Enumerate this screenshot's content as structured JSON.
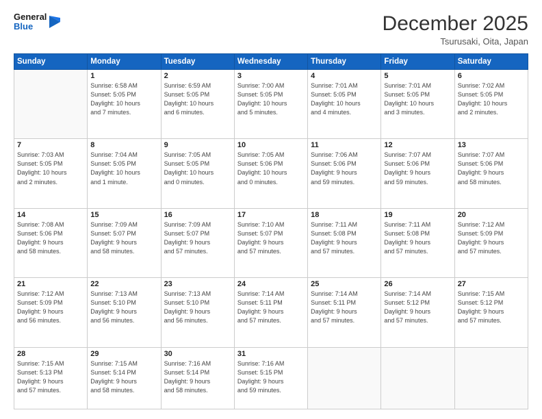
{
  "logo": {
    "line1": "General",
    "line2": "Blue"
  },
  "header": {
    "month_year": "December 2025",
    "location": "Tsurusaki, Oita, Japan"
  },
  "weekdays": [
    "Sunday",
    "Monday",
    "Tuesday",
    "Wednesday",
    "Thursday",
    "Friday",
    "Saturday"
  ],
  "weeks": [
    [
      {
        "day": "",
        "info": ""
      },
      {
        "day": "1",
        "info": "Sunrise: 6:58 AM\nSunset: 5:05 PM\nDaylight: 10 hours\nand 7 minutes."
      },
      {
        "day": "2",
        "info": "Sunrise: 6:59 AM\nSunset: 5:05 PM\nDaylight: 10 hours\nand 6 minutes."
      },
      {
        "day": "3",
        "info": "Sunrise: 7:00 AM\nSunset: 5:05 PM\nDaylight: 10 hours\nand 5 minutes."
      },
      {
        "day": "4",
        "info": "Sunrise: 7:01 AM\nSunset: 5:05 PM\nDaylight: 10 hours\nand 4 minutes."
      },
      {
        "day": "5",
        "info": "Sunrise: 7:01 AM\nSunset: 5:05 PM\nDaylight: 10 hours\nand 3 minutes."
      },
      {
        "day": "6",
        "info": "Sunrise: 7:02 AM\nSunset: 5:05 PM\nDaylight: 10 hours\nand 2 minutes."
      }
    ],
    [
      {
        "day": "7",
        "info": "Sunrise: 7:03 AM\nSunset: 5:05 PM\nDaylight: 10 hours\nand 2 minutes."
      },
      {
        "day": "8",
        "info": "Sunrise: 7:04 AM\nSunset: 5:05 PM\nDaylight: 10 hours\nand 1 minute."
      },
      {
        "day": "9",
        "info": "Sunrise: 7:05 AM\nSunset: 5:05 PM\nDaylight: 10 hours\nand 0 minutes."
      },
      {
        "day": "10",
        "info": "Sunrise: 7:05 AM\nSunset: 5:06 PM\nDaylight: 10 hours\nand 0 minutes."
      },
      {
        "day": "11",
        "info": "Sunrise: 7:06 AM\nSunset: 5:06 PM\nDaylight: 9 hours\nand 59 minutes."
      },
      {
        "day": "12",
        "info": "Sunrise: 7:07 AM\nSunset: 5:06 PM\nDaylight: 9 hours\nand 59 minutes."
      },
      {
        "day": "13",
        "info": "Sunrise: 7:07 AM\nSunset: 5:06 PM\nDaylight: 9 hours\nand 58 minutes."
      }
    ],
    [
      {
        "day": "14",
        "info": "Sunrise: 7:08 AM\nSunset: 5:06 PM\nDaylight: 9 hours\nand 58 minutes."
      },
      {
        "day": "15",
        "info": "Sunrise: 7:09 AM\nSunset: 5:07 PM\nDaylight: 9 hours\nand 58 minutes."
      },
      {
        "day": "16",
        "info": "Sunrise: 7:09 AM\nSunset: 5:07 PM\nDaylight: 9 hours\nand 57 minutes."
      },
      {
        "day": "17",
        "info": "Sunrise: 7:10 AM\nSunset: 5:07 PM\nDaylight: 9 hours\nand 57 minutes."
      },
      {
        "day": "18",
        "info": "Sunrise: 7:11 AM\nSunset: 5:08 PM\nDaylight: 9 hours\nand 57 minutes."
      },
      {
        "day": "19",
        "info": "Sunrise: 7:11 AM\nSunset: 5:08 PM\nDaylight: 9 hours\nand 57 minutes."
      },
      {
        "day": "20",
        "info": "Sunrise: 7:12 AM\nSunset: 5:09 PM\nDaylight: 9 hours\nand 57 minutes."
      }
    ],
    [
      {
        "day": "21",
        "info": "Sunrise: 7:12 AM\nSunset: 5:09 PM\nDaylight: 9 hours\nand 56 minutes."
      },
      {
        "day": "22",
        "info": "Sunrise: 7:13 AM\nSunset: 5:10 PM\nDaylight: 9 hours\nand 56 minutes."
      },
      {
        "day": "23",
        "info": "Sunrise: 7:13 AM\nSunset: 5:10 PM\nDaylight: 9 hours\nand 56 minutes."
      },
      {
        "day": "24",
        "info": "Sunrise: 7:14 AM\nSunset: 5:11 PM\nDaylight: 9 hours\nand 57 minutes."
      },
      {
        "day": "25",
        "info": "Sunrise: 7:14 AM\nSunset: 5:11 PM\nDaylight: 9 hours\nand 57 minutes."
      },
      {
        "day": "26",
        "info": "Sunrise: 7:14 AM\nSunset: 5:12 PM\nDaylight: 9 hours\nand 57 minutes."
      },
      {
        "day": "27",
        "info": "Sunrise: 7:15 AM\nSunset: 5:12 PM\nDaylight: 9 hours\nand 57 minutes."
      }
    ],
    [
      {
        "day": "28",
        "info": "Sunrise: 7:15 AM\nSunset: 5:13 PM\nDaylight: 9 hours\nand 57 minutes."
      },
      {
        "day": "29",
        "info": "Sunrise: 7:15 AM\nSunset: 5:14 PM\nDaylight: 9 hours\nand 58 minutes."
      },
      {
        "day": "30",
        "info": "Sunrise: 7:16 AM\nSunset: 5:14 PM\nDaylight: 9 hours\nand 58 minutes."
      },
      {
        "day": "31",
        "info": "Sunrise: 7:16 AM\nSunset: 5:15 PM\nDaylight: 9 hours\nand 59 minutes."
      },
      {
        "day": "",
        "info": ""
      },
      {
        "day": "",
        "info": ""
      },
      {
        "day": "",
        "info": ""
      }
    ]
  ]
}
